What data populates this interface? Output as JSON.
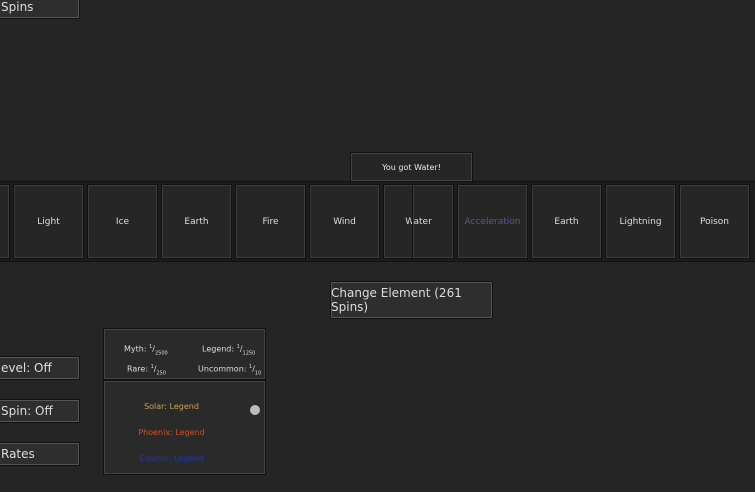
{
  "left_buttons": [
    "Spins",
    "evel: Off",
    "Spin: Off",
    "Rates"
  ],
  "banner": "You got Water!",
  "tiles": [
    "Light",
    "Ice",
    "Earth",
    "Fire",
    "Wind",
    "Water",
    "Acceleration",
    "Earth",
    "Lightning",
    "Poison"
  ],
  "change_button": "Change Element (261 Spins)",
  "rates": {
    "myth": "Myth: ",
    "myth_d": "2500",
    "legend": "Legend: ",
    "legend_d": "1250",
    "rare": "Rare: ",
    "rare_d": "250",
    "uncommon": "Uncommon: ",
    "uncommon_d": "10",
    "num": "1"
  },
  "specials": [
    {
      "label": "Solar: Legend",
      "color": "#c9a24a"
    },
    {
      "label": "Phoenix: Legend",
      "color": "#d2521c"
    },
    {
      "label": "Cosmic: Legend",
      "color": "#2038b8"
    }
  ],
  "accent_colors": {
    "acceleration": "#5a5890"
  }
}
